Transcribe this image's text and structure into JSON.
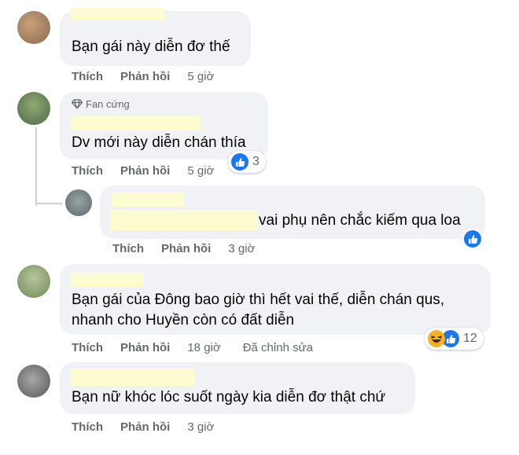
{
  "comments": [
    {
      "text": "Bạn gái này diễn đơ thế",
      "like": "Thích",
      "reply": "Phản hồi",
      "time": "5 giờ"
    },
    {
      "badge": "Fan cứng",
      "text": "Dv mới này diễn chán thía",
      "like": "Thích",
      "reply": "Phản hồi",
      "time": "5 giờ",
      "reaction_count": "3"
    },
    {
      "text": "vai phụ nên chắc kiếm qua loa",
      "like": "Thích",
      "reply": "Phản hồi",
      "time": "3 giờ"
    },
    {
      "text_line1": "Bạn gái của Đông bao giờ thì hết vai thế, diễn chán qus,",
      "text_line2": "nhanh cho Huyền còn có đất diễn",
      "like": "Thích",
      "reply": "Phản hồi",
      "time": "18 giờ",
      "edited": "Đã chỉnh sửa",
      "reaction_count": "12"
    },
    {
      "text": "Bạn nữ khóc lóc suốt ngày kia diễn đơ thật chứ",
      "like": "Thích",
      "reply": "Phản hồi",
      "time": "3 giờ"
    }
  ],
  "colors": {
    "bubble": "#f0f2f5",
    "like_blue": "#1877f2",
    "meta_gray": "#65676b",
    "redaction": "#fdfbd0"
  },
  "icons": {
    "badge": "diamond-icon",
    "like": "like-thumb-icon",
    "haha": "haha-emoji-icon"
  }
}
